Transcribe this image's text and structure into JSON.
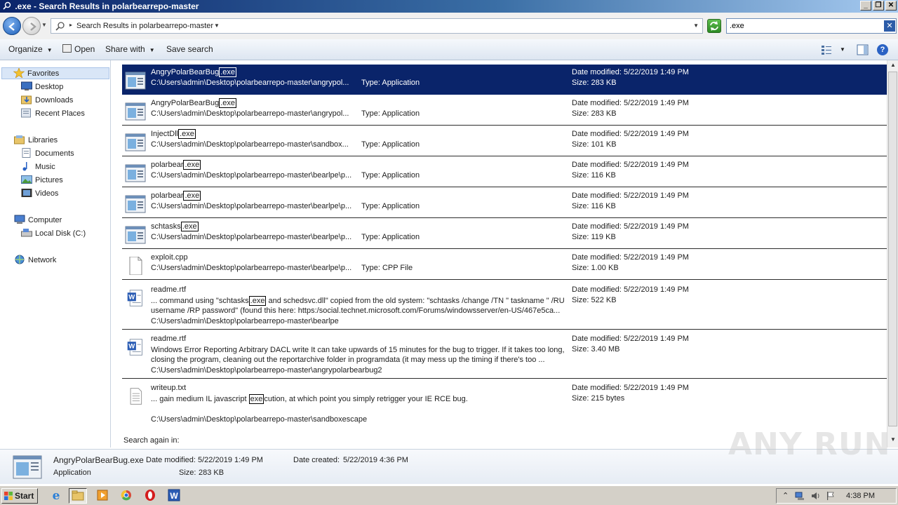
{
  "window": {
    "title": ".exe - Search Results in polarbearrepo-master"
  },
  "address": {
    "crumb": "Search Results in polarbearrepo-master"
  },
  "search": {
    "value": ".exe"
  },
  "toolbar": {
    "organize": "Organize",
    "open": "Open",
    "share_with": "Share with",
    "save_search": "Save search"
  },
  "nav": {
    "favorites": "Favorites",
    "desktop": "Desktop",
    "downloads": "Downloads",
    "recent": "Recent Places",
    "libraries": "Libraries",
    "documents": "Documents",
    "music": "Music",
    "pictures": "Pictures",
    "videos": "Videos",
    "computer": "Computer",
    "local_disk": "Local Disk (C:)",
    "network": "Network"
  },
  "results": [
    {
      "name_pre": "AngryPolarBearBug",
      "name_hl": ".exe",
      "path": "C:\\Users\\admin\\Desktop\\polarbearrepo-master\\angrypol...",
      "type": "Type: Application",
      "date": "Date modified: 5/22/2019 1:49 PM",
      "size": "Size: 283 KB"
    },
    {
      "name_pre": "AngryPolarBearBug",
      "name_hl": ".exe",
      "path": "C:\\Users\\admin\\Desktop\\polarbearrepo-master\\angrypol...",
      "type": "Type: Application",
      "date": "Date modified: 5/22/2019 1:49 PM",
      "size": "Size: 283 KB"
    },
    {
      "name_pre": "InjectDll",
      "name_hl": ".exe",
      "path": "C:\\Users\\admin\\Desktop\\polarbearrepo-master\\sandbox...",
      "type": "Type: Application",
      "date": "Date modified: 5/22/2019 1:49 PM",
      "size": "Size: 101 KB"
    },
    {
      "name_pre": "polarbear",
      "name_hl": ".exe",
      "path": "C:\\Users\\admin\\Desktop\\polarbearrepo-master\\bearlpe\\p...",
      "type": "Type: Application",
      "date": "Date modified: 5/22/2019 1:49 PM",
      "size": "Size: 116 KB"
    },
    {
      "name_pre": "polarbear",
      "name_hl": ".exe",
      "path": "C:\\Users\\admin\\Desktop\\polarbearrepo-master\\bearlpe\\p...",
      "type": "Type: Application",
      "date": "Date modified: 5/22/2019 1:49 PM",
      "size": "Size: 116 KB"
    },
    {
      "name_pre": "schtasks",
      "name_hl": ".exe",
      "path": "C:\\Users\\admin\\Desktop\\polarbearrepo-master\\bearlpe\\p...",
      "type": "Type: Application",
      "date": "Date modified: 5/22/2019 1:49 PM",
      "size": "Size: 119 KB"
    },
    {
      "name_pre": "exploit.cpp",
      "name_hl": "",
      "path": "C:\\Users\\admin\\Desktop\\polarbearrepo-master\\bearlpe\\p...",
      "type": "Type: CPP File",
      "date": "Date modified: 5/22/2019 1:49 PM",
      "size": "Size: 1.00 KB"
    }
  ],
  "doc_results": [
    {
      "name": "readme.rtf",
      "snip_pre": "... command using \"schtasks",
      "snip_hl": ".exe",
      "snip_post": " and schedsvc.dll\" copied from the old system: \"schtasks /change /TN \" taskname \" /RU username /RP password\" (found this here: https:/social.technet.microsoft.com/Forums/windowsserver/en-US/467e5ca...",
      "path": "C:\\Users\\admin\\Desktop\\polarbearrepo-master\\bearlpe",
      "date": "Date modified: 5/22/2019 1:49 PM",
      "size": "Size: 522 KB"
    },
    {
      "name": "readme.rtf",
      "snip_pre": "Windows Error Reporting Arbitrary DACL write It can take upwards of 15 minutes for the bug to trigger. If it takes too long, closing the program, cleaning out the reportarchive folder in programdata (it may mess up the timing if there's too ...",
      "snip_hl": "",
      "snip_post": "",
      "path": "C:\\Users\\admin\\Desktop\\polarbearrepo-master\\angrypolarbearbug2",
      "date": "Date modified: 5/22/2019 1:49 PM",
      "size": "Size: 3.40 MB"
    },
    {
      "name": "writeup.txt",
      "snip_pre": "... gain medium IL javascript ",
      "snip_hl": "exe",
      "snip_post": "cution, at which point you simply retrigger your IE RCE bug.",
      "path": "C:\\Users\\admin\\Desktop\\polarbearrepo-master\\sandboxescape",
      "date": "Date modified: 5/22/2019 1:49 PM",
      "size": "Size: 215 bytes"
    }
  ],
  "search_again": "Search again in:",
  "details": {
    "name": "AngryPolarBearBug.exe",
    "type": "Application",
    "modified_label": "Date modified:",
    "modified_value": "5/22/2019 1:49 PM",
    "created_label": "Date created:",
    "created_value": "5/22/2019 4:36 PM",
    "size_label": "Size:",
    "size_value": "283 KB"
  },
  "taskbar": {
    "start": "Start",
    "clock": "4:38 PM"
  },
  "watermark": "ANY RUN",
  "colors": {
    "selection": "#0a246a",
    "title_gradient_start": "#0a246a"
  }
}
